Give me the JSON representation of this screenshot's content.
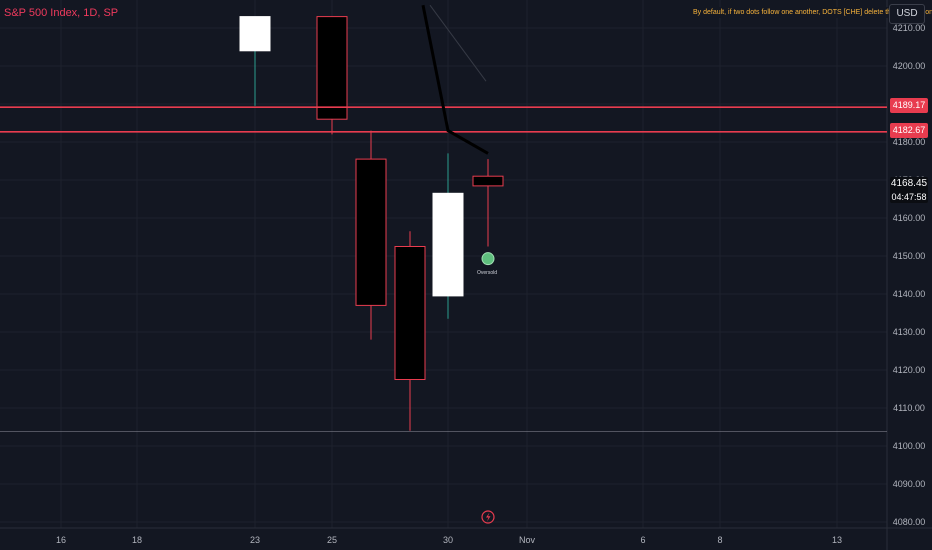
{
  "header": {
    "symbol_title": "S&P 500 Index, 1D, SP",
    "note": "By default, if two dots follow one another, DOTS [CHE] delete the previous one",
    "currency": "USD"
  },
  "price_tags": {
    "line1": "4189.17",
    "line2": "4182.67",
    "last_price": "4168.45",
    "countdown": "04:47:58"
  },
  "indicator": {
    "label": "Oversold",
    "dot_color": "#5fbf7e"
  },
  "colors": {
    "background": "#131722",
    "up_body": "#ffffff",
    "down_body": "#000000",
    "down_border": "#e83c4f",
    "up_wick": "#2b9d8f",
    "horizontal_line": "#e83c4f",
    "trend_line": "#000000"
  },
  "icons": {
    "event_marker": "lightning-icon"
  },
  "chart_data": {
    "type": "candlestick",
    "title": "",
    "y_range": [
      4078,
      4213
    ],
    "y_ticks": [
      4080,
      4090,
      4100,
      4110,
      4120,
      4130,
      4140,
      4150,
      4160,
      4170,
      4180,
      4190,
      4200,
      4210
    ],
    "y_tick_labels": [
      "4080.00",
      "4090.00",
      "4100.00",
      "4110.00",
      "4120.00",
      "4130.00",
      "4140.00",
      "4150.00",
      "4160.00",
      "4170.00",
      "4180.00",
      "4190.00",
      "4200.00",
      "4210.00"
    ],
    "x_tick_labels": [
      "16",
      "18",
      "23",
      "25",
      "30",
      "Nov",
      "6",
      "8",
      "13"
    ],
    "candles": [
      {
        "date": "Oct 23",
        "open": 4204,
        "high": 4213,
        "low": 4189.5,
        "close": 4213,
        "dir": "up"
      },
      {
        "date": "Oct 25",
        "open": 4213,
        "high": 4213,
        "low": 4182,
        "close": 4186,
        "dir": "down"
      },
      {
        "date": "Oct 26",
        "open": 4175.5,
        "high": 4183,
        "low": 4128,
        "close": 4137,
        "dir": "down"
      },
      {
        "date": "Oct 27",
        "open": 4152.5,
        "high": 4156.5,
        "low": 4104,
        "close": 4117.5,
        "dir": "down"
      },
      {
        "date": "Oct 30",
        "open": 4139.5,
        "high": 4177,
        "low": 4133.5,
        "close": 4166.5,
        "dir": "up"
      },
      {
        "date": "Oct 31",
        "open": 4171,
        "high": 4175.5,
        "low": 4152.5,
        "close": 4168.45,
        "dir": "down"
      }
    ],
    "horizontal_lines": [
      4189.17,
      4182.67
    ],
    "support_line": 4103.8,
    "trend_line": [
      {
        "date": "Oct 25",
        "value": 4216
      },
      {
        "date": "Oct 30",
        "value": 4183
      },
      {
        "date": "Oct 31",
        "value": 4177
      }
    ],
    "faint_line": [
      {
        "date": "Oct 27",
        "value": 4216
      },
      {
        "date": "Oct 31",
        "value": 4196
      }
    ],
    "oversold_point": {
      "date": "Oct 31",
      "value": 4149.3
    },
    "last_price": 4168.45,
    "grid": true
  }
}
